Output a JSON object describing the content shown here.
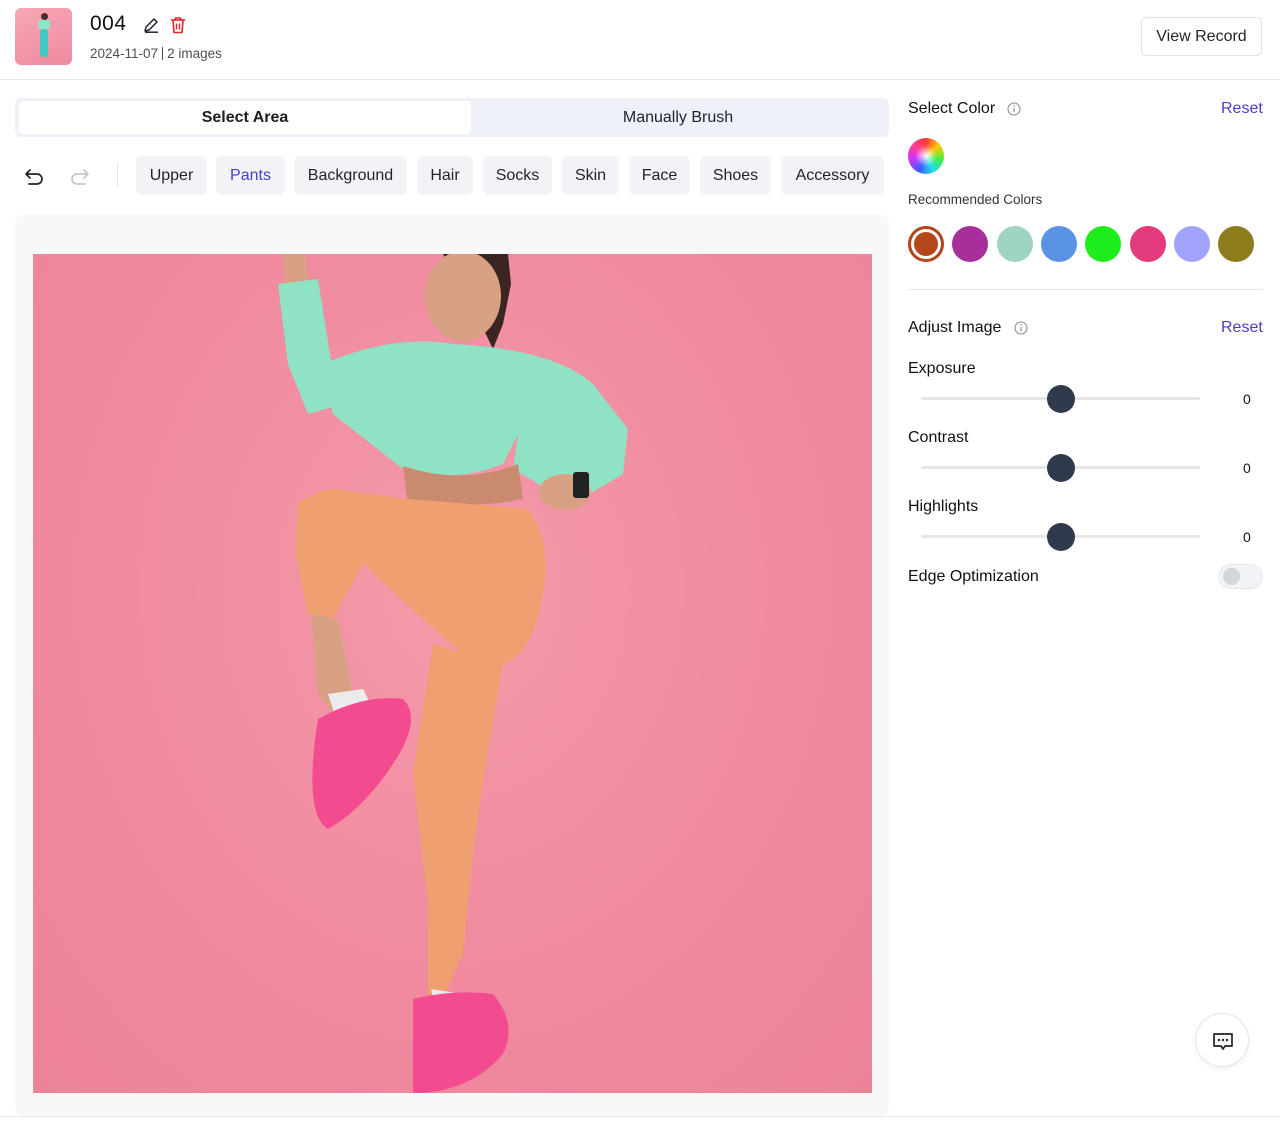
{
  "header": {
    "title": "004",
    "date": "2024-11-07",
    "image_count": "2 images",
    "view_record_label": "View Record",
    "icons": [
      "edit-icon",
      "trash-icon"
    ]
  },
  "mode_tabs": {
    "active": "Select Area",
    "inactive": "Manually Brush"
  },
  "toolbar": {
    "icons": [
      "undo-icon",
      "redo-icon"
    ],
    "selected": "Pants",
    "areas": [
      "Upper",
      "Pants",
      "Background",
      "Hair",
      "Socks",
      "Skin",
      "Face",
      "Shoes",
      "Accessory"
    ]
  },
  "select_color": {
    "title": "Select Color",
    "reset_label": "Reset",
    "recommended_label": "Recommended Colors",
    "selected_color": "#b5451b",
    "recommended_colors": [
      "#b5451b",
      "#a82e9b",
      "#9fd4c1",
      "#5b93e4",
      "#1ded1d",
      "#e33a7c",
      "#a1a3fb",
      "#8c7c1c"
    ]
  },
  "adjust_image": {
    "title": "Adjust Image",
    "reset_label": "Reset",
    "exposure": {
      "label": "Exposure",
      "value": "0"
    },
    "contrast": {
      "label": "Contrast",
      "value": "0"
    },
    "highlights": {
      "label": "Highlights",
      "value": "0"
    },
    "edge_optimization": {
      "label": "Edge Optimization",
      "enabled": false
    }
  },
  "colors": {
    "accent": "#4b3fc7",
    "photo_background": "#f08a9f",
    "top_garment": "#8fe3c4",
    "pants_garment": "#f0a070",
    "shoes": "#f24b8f"
  },
  "floating": {
    "icon": "chat-icon"
  }
}
